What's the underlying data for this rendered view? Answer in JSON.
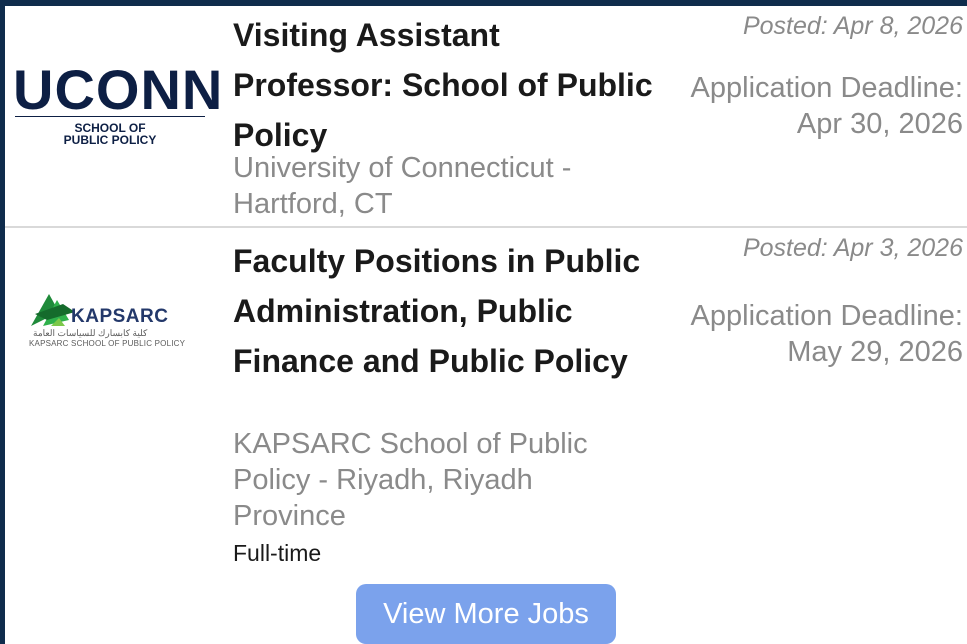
{
  "jobs": [
    {
      "logo": {
        "wordmark": "UCONN",
        "sub_line1": "SCHOOL OF",
        "sub_line2": "PUBLIC POLICY"
      },
      "title": "Visiting Assistant Professor: School of Public Policy",
      "organization": "University of Connecticut - Hartford, CT",
      "posted": "Posted: Apr 8, 2026",
      "deadline": "Application Deadline: Apr 30, 2026"
    },
    {
      "logo": {
        "wordmark": "KAPSARC",
        "arabic": "كلية كابسارك للسياسات العامة",
        "sub_line": "KAPSARC SCHOOL OF PUBLIC POLICY"
      },
      "title": "Faculty Positions in Public Administration, Public Finance and Public Policy",
      "organization": "KAPSARC School of Public Policy - Riyadh, Riyadh Province",
      "job_type": "Full-time",
      "posted": "Posted: Apr 3, 2026",
      "deadline": "Application Deadline: May 29, 2026"
    }
  ],
  "view_more_label": "View More Jobs",
  "colors": {
    "background": "#0f2c4c",
    "button": "#7ba2ec",
    "title_text": "#1a1a1a",
    "muted_text": "#8a8a8a"
  }
}
